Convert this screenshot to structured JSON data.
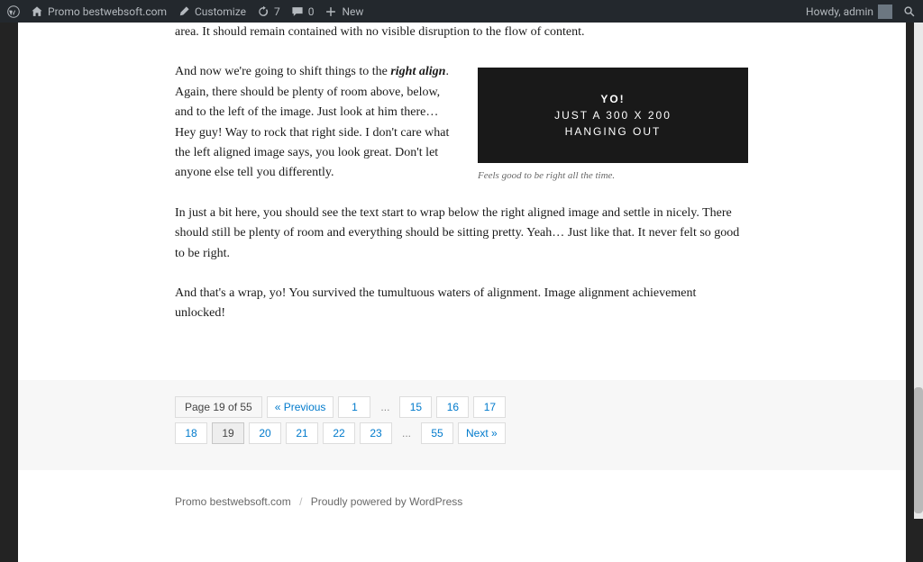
{
  "adminbar": {
    "site_name": "Promo bestwebsoft.com",
    "customize": "Customize",
    "updates_count": "7",
    "comments_count": "0",
    "new": "New",
    "howdy": "Howdy, admin"
  },
  "content": {
    "p0_tail": "area. It should remain contained with no visible disruption to the flow of content.",
    "p1_pre": "And now we're going to shift things to the ",
    "p1_em": "right align",
    "p1_post": ". Again, there should be plenty of room above, below, and to the left of the image. Just look at him there… Hey guy! Way to rock that right side. I don't care what the left aligned image says, you look great. Don't let anyone else tell you differently.",
    "img_box_l1": "YO!",
    "img_box_l2": "JUST A 300 X 200",
    "img_box_l3": "HANGING OUT",
    "figcap": "Feels good to be right all the time.",
    "p2": "In just a bit here, you should see the text start to wrap below the right aligned image and settle in nicely. There should still be plenty of room and everything should be sitting pretty. Yeah… Just like that. It never felt so good to be right.",
    "p3": "And that's a wrap, yo! You survived the tumultuous waters of alignment. Image alignment achievement unlocked!"
  },
  "pager": {
    "page_label": "Page 19 of 55",
    "prev": "« Previous",
    "next": "Next »",
    "row1": [
      "1",
      "...",
      "15",
      "16",
      "17"
    ],
    "row2": [
      "18",
      "19",
      "20",
      "21",
      "22",
      "23",
      "...",
      "55"
    ],
    "current": "19"
  },
  "footer": {
    "site": "Promo bestwebsoft.com",
    "powered": "Proudly powered by WordPress"
  }
}
